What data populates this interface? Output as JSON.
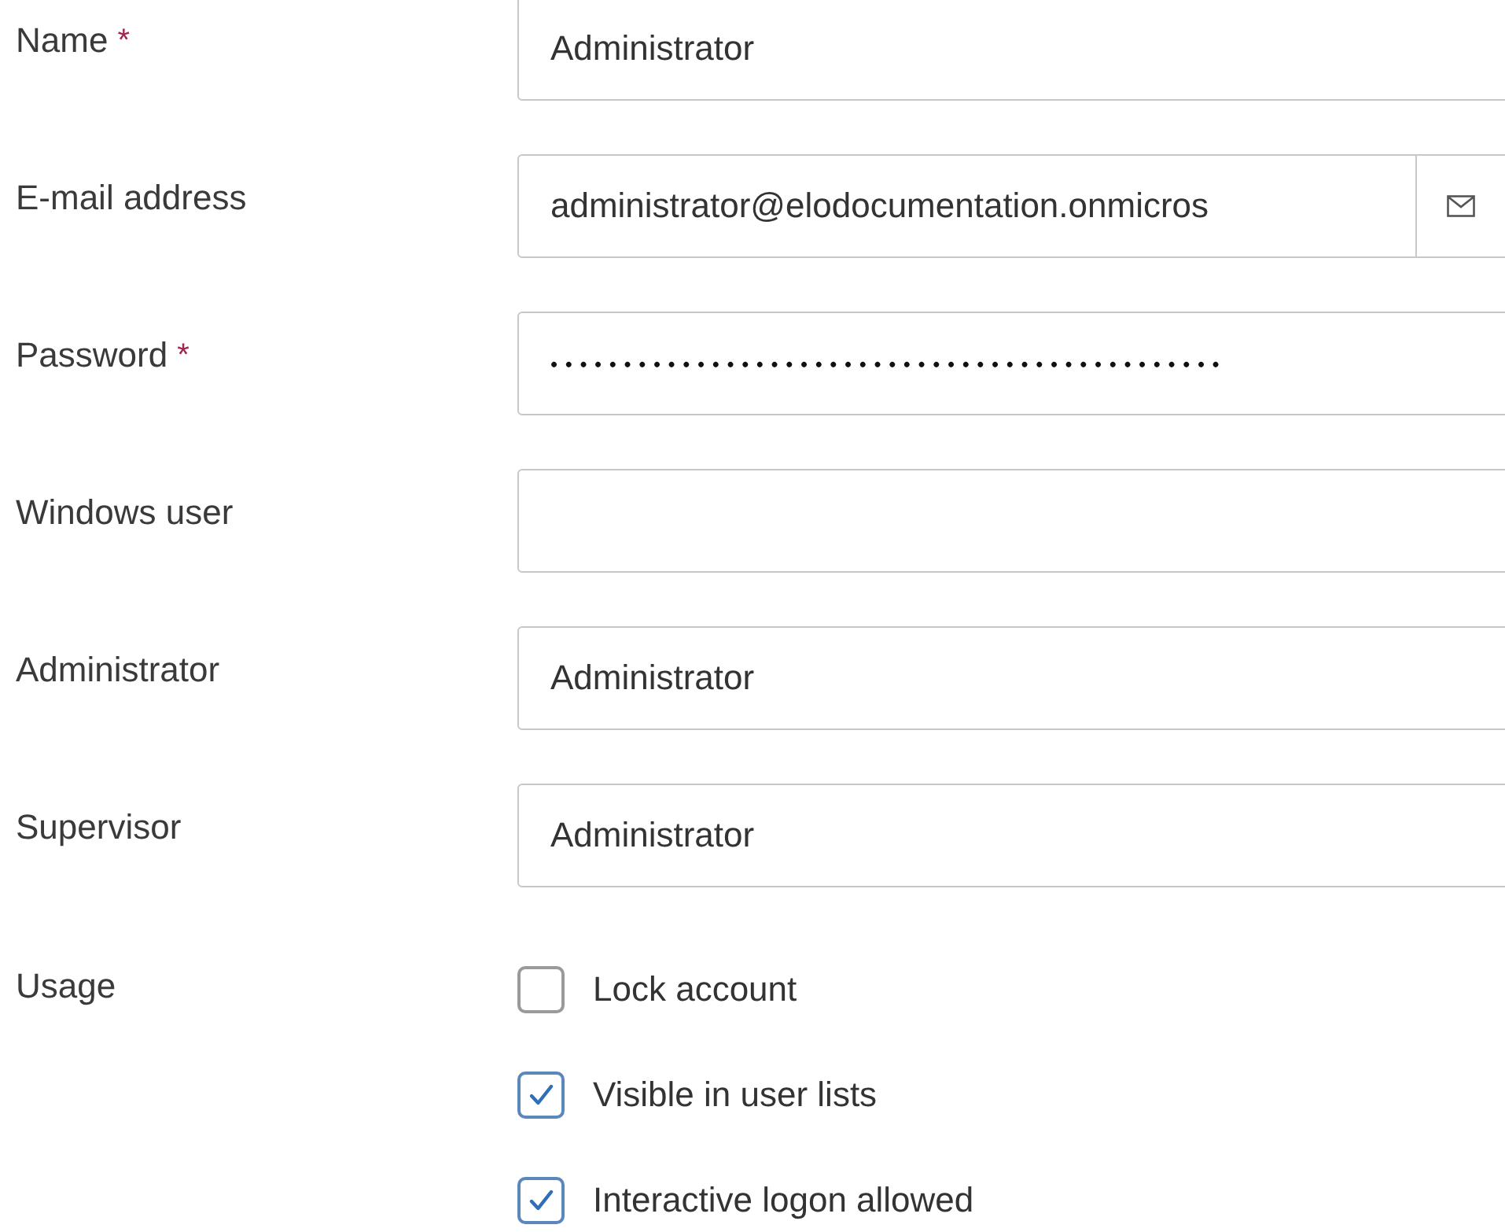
{
  "fields": [
    {
      "label": "Name",
      "required_mark": "*",
      "value": "Administrator"
    },
    {
      "label": "E-mail address",
      "value": "administrator@elodocumentation.onmicros",
      "kind": "email"
    },
    {
      "label": "Password",
      "required_mark": "*",
      "value": "••••••••••••••••••••••••••••••••••••••••••••••",
      "kind": "password"
    },
    {
      "label": "Windows user"
    },
    {
      "label": "Administrator",
      "value": "Administrator"
    },
    {
      "label": "Supervisor",
      "value": "Administrator"
    }
  ],
  "usage": {
    "label": "Usage",
    "options": [
      {
        "label": "Lock account",
        "checked": false
      },
      {
        "label": "Visible in user lists",
        "checked": true
      },
      {
        "label": "Interactive logon allowed",
        "checked": true
      }
    ]
  }
}
